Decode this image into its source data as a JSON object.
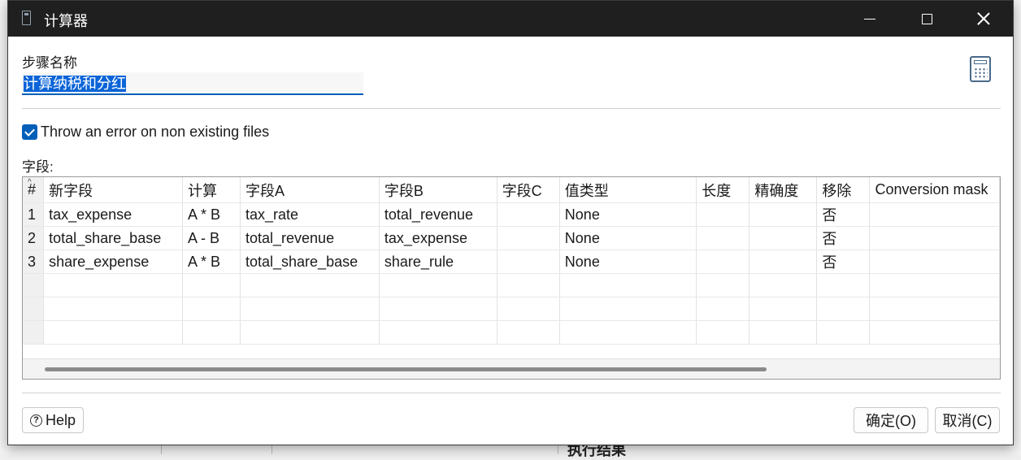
{
  "window": {
    "title": "计算器"
  },
  "form": {
    "step_name_label": "步骤名称",
    "step_name_value": "计算纳税和分红",
    "checkbox_label": "Throw an error on non existing files",
    "checkbox_checked": true,
    "fields_label": "字段:"
  },
  "table": {
    "columns": [
      "#",
      "新字段",
      "计算",
      "字段A",
      "字段B",
      "字段C",
      "值类型",
      "长度",
      "精确度",
      "移除",
      "Conversion mask"
    ],
    "rows": [
      [
        "1",
        "tax_expense",
        "A * B",
        "tax_rate",
        "total_revenue",
        "",
        "None",
        "",
        "",
        "否",
        ""
      ],
      [
        "2",
        "total_share_base",
        "A - B",
        "total_revenue",
        "tax_expense",
        "",
        "None",
        "",
        "",
        "否",
        ""
      ],
      [
        "3",
        "share_expense",
        "A * B",
        "total_share_base",
        "share_rule",
        "",
        "None",
        "",
        "",
        "否",
        ""
      ]
    ]
  },
  "buttons": {
    "help": "Help",
    "ok": "确定(O)",
    "cancel": "取消(C)"
  },
  "background": {
    "bottom_text": "执行结果"
  },
  "colors": {
    "accent": "#005fb8",
    "titlebar": "#1f1f1f"
  }
}
